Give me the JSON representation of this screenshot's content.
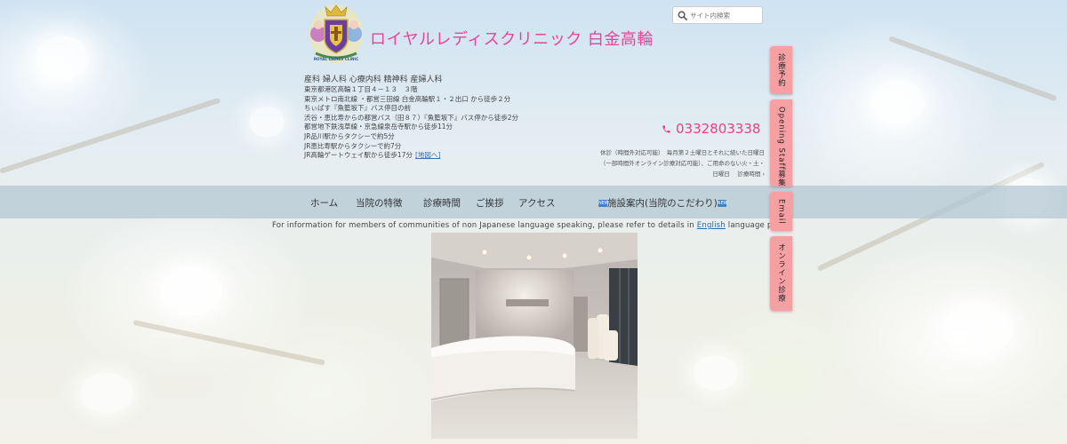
{
  "header": {
    "logo_text": "ROYAL LADIES CLINIC",
    "site_title": "ロイヤルレディスクリニック 白金高輪",
    "departments": "産科 婦人科 心療内科 精神科 産婦人科",
    "access_lines": [
      "東京都港区高輪１丁目４－１３　３階",
      "東京メトロ南北線 ・都営三田線 白金高輪駅１・２出口 から徒歩２分",
      "ちぃばす『魚籃坂下』バス停目の前",
      "渋谷・恵比寿からの都営バス（田８７）『魚籃坂下』バス停から徒歩2分",
      "都営地下鉄浅草線・京急線泉岳寺駅から徒歩11分",
      "JR品川駅からタクシーで約5分",
      "JR恵比寿駅からタクシーで約7分",
      "JR高輪ゲートウェイ駅から徒歩17分"
    ],
    "map_link": "[地図へ]"
  },
  "search": {
    "placeholder": "サイト内検索",
    "value": ""
  },
  "contact": {
    "phone": "0332803338",
    "hours_lines": [
      "休診（時間外対応可能）　毎月第２土曜日とそれに続いた日曜日",
      "（一部時間外オンライン診療対応可能）、ご用命のない火・土・",
      "日曜日　 診療時間 ›"
    ]
  },
  "nav": {
    "items": [
      "ホーム",
      "当院の特徴",
      "診療時間",
      "ご挨拶",
      "アクセス"
    ],
    "badge": "NEW",
    "facility": "施設案内(当院のこだわり)"
  },
  "notice": {
    "before": "For information for members of communities of non Japanese language speaking, please refer to details in ",
    "link": "English",
    "after": " language page."
  },
  "side_tabs": [
    "診療予約",
    "Opening Staff募集",
    "Email",
    "オンライン診療"
  ],
  "colors": {
    "title_pink": "#e5469a",
    "phone_pink": "#ee3f7e",
    "side_tab_pink": "#f7a0a3",
    "nav_band": "#b4c8d4",
    "link_blue": "#2766a8"
  }
}
